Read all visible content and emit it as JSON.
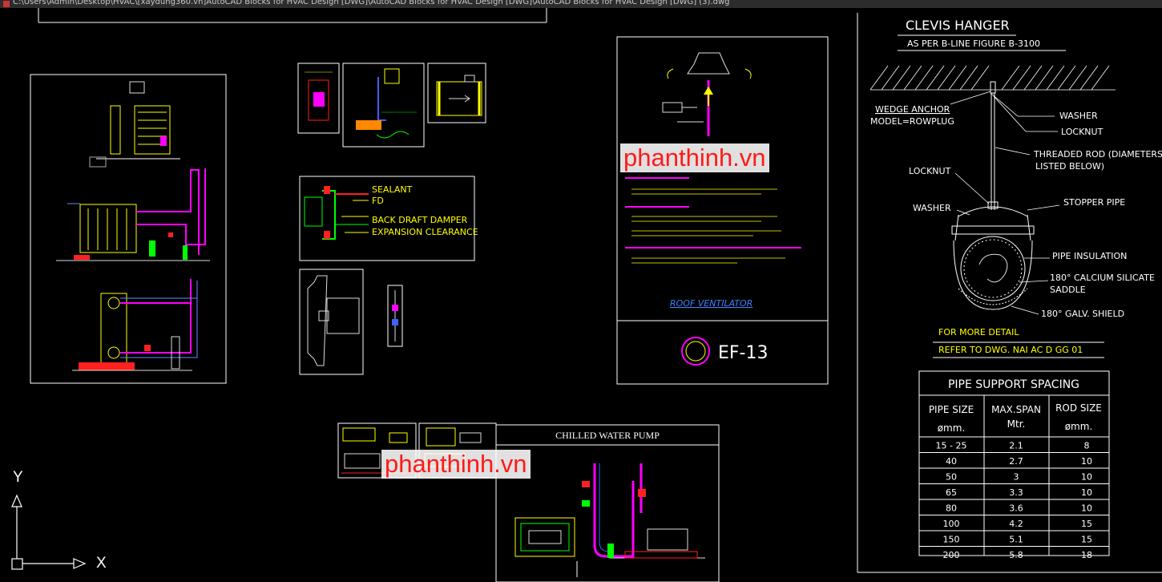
{
  "window": {
    "title": "C:\\Users\\Admin\\Desktop\\HVAC\\[xaydung360.vn]AutoCAD Blocks for HVAC Design [DWG]\\AutoCAD Blocks for HVAC Design [DWG]\\AutoCAD Blocks for HVAC Design [DWG] (3).dwg"
  },
  "watermark": "phanthinh.vn",
  "ucs": {
    "y_label": "Y",
    "x_label": "X"
  },
  "damper": {
    "labels": [
      "SEALANT",
      "FD",
      "BACK DRAFT DAMPER",
      "EXPANSION CLEARANCE"
    ]
  },
  "roof_ventilator": {
    "caption": "ROOF VENTILATOR",
    "tag": "EF-13"
  },
  "pump": {
    "title": "CHILLED WATER PUMP"
  },
  "clevis": {
    "title": "CLEVIS HANGER",
    "subtitle": "AS PER B-LINE FIGURE B-3100",
    "wedge_anchor": "WEDGE ANCHOR",
    "model": "MODEL=ROWPLUG",
    "washer_top": "WASHER",
    "locknut_top": "LOCKNUT",
    "threaded_rod": "THREADED ROD (DIAMETERS",
    "listed_below": "LISTED BELOW)",
    "locknut_left": "LOCKNUT",
    "washer_left": "WASHER",
    "stopper_pipe": "STOPPER PIPE",
    "pipe_insulation": "PIPE INSULATION",
    "calcium": "180° CALCIUM SILICATE",
    "saddle": "SADDLE",
    "galv_shield": "180° GALV. SHIELD",
    "more_detail": "FOR MORE DETAIL",
    "refer": "REFER TO DWG. NAI AC D GG 01"
  },
  "spacing_table": {
    "title": "PIPE SUPPORT SPACING",
    "headers": [
      {
        "line1": "PIPE SIZE",
        "line2": "ømm."
      },
      {
        "line1": "MAX.SPAN",
        "line2": "Mtr."
      },
      {
        "line1": "ROD SIZE",
        "line2": "ømm."
      }
    ],
    "rows": [
      [
        "15 - 25",
        "2.1",
        "8"
      ],
      [
        "40",
        "2.7",
        "10"
      ],
      [
        "50",
        "3",
        "10"
      ],
      [
        "65",
        "3.3",
        "10"
      ],
      [
        "80",
        "3.6",
        "10"
      ],
      [
        "100",
        "4.2",
        "15"
      ],
      [
        "150",
        "5.1",
        "15"
      ],
      [
        "200",
        "5.8",
        "18"
      ]
    ]
  },
  "colors": {
    "background": "#000000",
    "sheet_border": "#ffffff",
    "cad_yellow": "#ffff00",
    "cad_magenta": "#ff00ff",
    "cad_red": "#ff2020",
    "cad_green": "#00ff00",
    "cad_blue": "#4060ff",
    "watermark_red": "#ff1a1a"
  }
}
